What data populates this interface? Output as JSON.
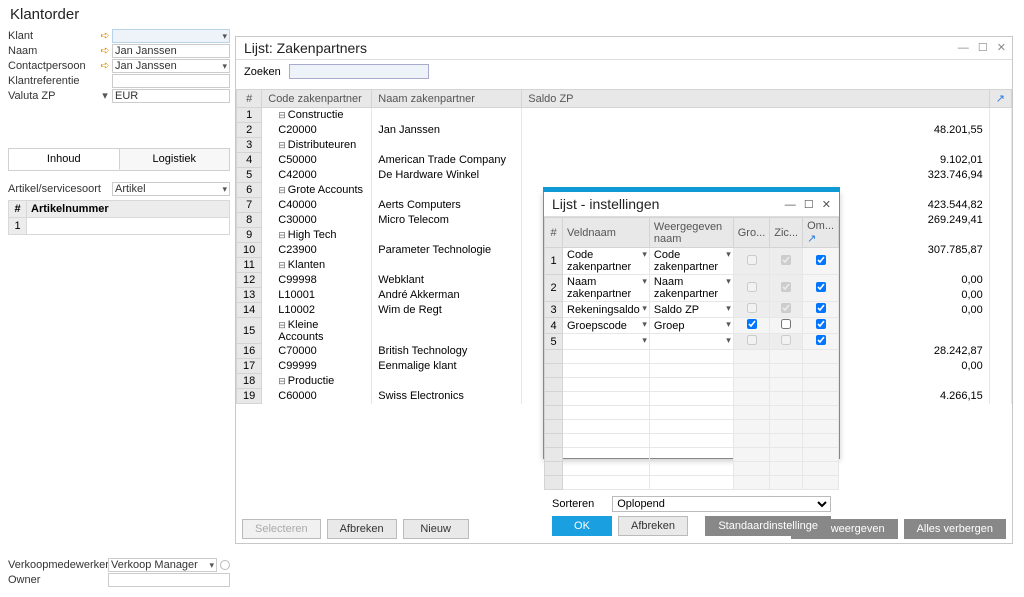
{
  "title": "Klantorder",
  "form": {
    "klant_label": "Klant",
    "klant_value": "",
    "naam_label": "Naam",
    "naam_value": "Jan Janssen",
    "contact_label": "Contactpersoon",
    "contact_value": "Jan Janssen",
    "klantref_label": "Klantreferentie",
    "klantref_value": "",
    "valuta_label": "Valuta ZP",
    "valuta_value": "EUR"
  },
  "tabs": {
    "inhoud": "Inhoud",
    "logistiek": "Logistiek"
  },
  "subform": {
    "artservice_label": "Artikel/servicesoort",
    "artservice_value": "Artikel",
    "col_num": "#",
    "col_art": "Artikelnummer",
    "row1_num": "1"
  },
  "list": {
    "title": "Lijst: Zakenpartners",
    "search_label": "Zoeken",
    "search_value": "",
    "columns": {
      "num": "#",
      "code": "Code zakenpartner",
      "name": "Naam zakenpartner",
      "saldo": "Saldo ZP"
    },
    "rows": [
      {
        "n": "1",
        "group": true,
        "code": "Constructie",
        "name": "",
        "saldo": ""
      },
      {
        "n": "2",
        "code": "C20000",
        "name": "Jan Janssen",
        "saldo": "48.201,55"
      },
      {
        "n": "3",
        "group": true,
        "code": "Distributeuren",
        "name": "",
        "saldo": ""
      },
      {
        "n": "4",
        "code": "C50000",
        "name": "American Trade Company",
        "saldo": "9.102,01"
      },
      {
        "n": "5",
        "code": "C42000",
        "name": "De Hardware Winkel",
        "saldo": "323.746,94"
      },
      {
        "n": "6",
        "group": true,
        "code": "Grote Accounts",
        "name": "",
        "saldo": ""
      },
      {
        "n": "7",
        "code": "C40000",
        "name": "Aerts Computers",
        "saldo": "423.544,82"
      },
      {
        "n": "8",
        "code": "C30000",
        "name": "Micro Telecom",
        "saldo": "269.249,41"
      },
      {
        "n": "9",
        "group": true,
        "code": "High Tech",
        "name": "",
        "saldo": ""
      },
      {
        "n": "10",
        "code": "C23900",
        "name": "Parameter Technologie",
        "saldo": "307.785,87"
      },
      {
        "n": "11",
        "group": true,
        "code": "Klanten",
        "name": "",
        "saldo": ""
      },
      {
        "n": "12",
        "code": "C99998",
        "name": "Webklant",
        "saldo": "0,00"
      },
      {
        "n": "13",
        "code": "L10001",
        "name": "André Akkerman",
        "saldo": "0,00"
      },
      {
        "n": "14",
        "code": "L10002",
        "name": "Wim de Regt",
        "saldo": "0,00"
      },
      {
        "n": "15",
        "group": true,
        "code": "Kleine Accounts",
        "name": "",
        "saldo": ""
      },
      {
        "n": "16",
        "code": "C70000",
        "name": "British Technology",
        "saldo": "28.242,87"
      },
      {
        "n": "17",
        "code": "C99999",
        "name": "Eenmalige klant",
        "saldo": "0,00"
      },
      {
        "n": "18",
        "group": true,
        "code": "Productie",
        "name": "",
        "saldo": ""
      },
      {
        "n": "19",
        "code": "C60000",
        "name": "Swiss Electronics",
        "saldo": "4.266,15"
      }
    ],
    "btn_select": "Selecteren",
    "btn_cancel": "Afbreken",
    "btn_new": "Nieuw",
    "btn_showall": "Alles weergeven",
    "btn_hideall": "Alles verbergen"
  },
  "dialog": {
    "title": "Lijst - instellingen",
    "columns": {
      "num": "#",
      "field": "Veldnaam",
      "disp": "Weergegeven naam",
      "group": "Gro...",
      "vis": "Zic...",
      "desc": "Om..."
    },
    "rows": [
      {
        "n": "1",
        "field": "Code zakenpartner",
        "disp": "Code zakenpartner",
        "g": false,
        "gdis": true,
        "v": true,
        "vdis": true,
        "d": true
      },
      {
        "n": "2",
        "field": "Naam zakenpartner",
        "disp": "Naam zakenpartner",
        "g": false,
        "gdis": true,
        "v": true,
        "vdis": true,
        "d": true
      },
      {
        "n": "3",
        "field": "Rekeningsaldo",
        "disp": "Saldo ZP",
        "g": false,
        "gdis": true,
        "v": true,
        "vdis": true,
        "d": true
      },
      {
        "n": "4",
        "field": "Groepscode",
        "disp": "Groep",
        "g": true,
        "gdis": false,
        "v": false,
        "vdis": false,
        "d": true
      },
      {
        "n": "5",
        "field": "",
        "disp": "",
        "g": false,
        "gdis": true,
        "v": false,
        "vdis": true,
        "d": true
      }
    ],
    "sort_label": "Sorteren",
    "sort_value": "Oplopend",
    "btn_ok": "OK",
    "btn_cancel": "Afbreken",
    "btn_defaults": "Standaardinstellinge"
  },
  "bottom": {
    "sales_label": "Verkoopmedewerker",
    "sales_value": "Verkoop Manager",
    "owner_label": "Owner",
    "owner_value": ""
  }
}
